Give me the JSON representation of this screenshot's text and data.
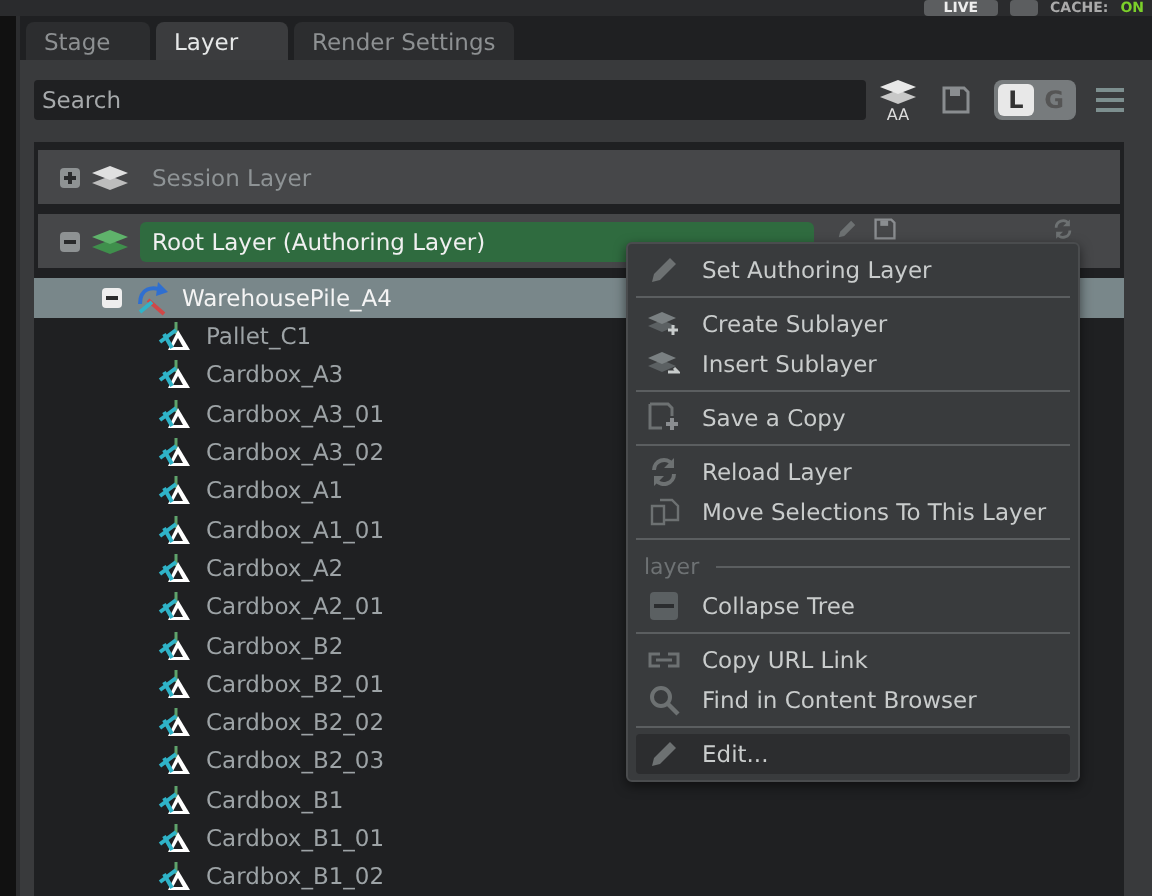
{
  "status": {
    "live": "LIVE",
    "cache_label": "CACHE:",
    "cache_value": "ON"
  },
  "tabs": [
    {
      "label": "Stage",
      "selected": false
    },
    {
      "label": "Layer",
      "selected": true
    },
    {
      "label": "Render Settings",
      "selected": false
    }
  ],
  "search": {
    "placeholder": "Search"
  },
  "toolbar": {
    "layers_caption": "AA",
    "toggle": [
      {
        "label": "L",
        "selected": true
      },
      {
        "label": "G",
        "selected": false
      }
    ]
  },
  "layers": [
    {
      "name": "Session Layer",
      "expanded": false,
      "authoring": false
    },
    {
      "name": "Root Layer (Authoring Layer)",
      "expanded": true,
      "authoring": true
    }
  ],
  "tree": [
    {
      "name": "WarehousePile_A4",
      "expanded": true,
      "selected": true,
      "children": [
        {
          "name": "Pallet_C1",
          "selected": false
        },
        {
          "name": "Cardbox_A3",
          "selected": false
        },
        {
          "name": "Cardbox_A3_01",
          "selected": false
        },
        {
          "name": "Cardbox_A3_02",
          "selected": false
        },
        {
          "name": "Cardbox_A1",
          "selected": false
        },
        {
          "name": "Cardbox_A1_01",
          "selected": false
        },
        {
          "name": "Cardbox_A2",
          "selected": false
        },
        {
          "name": "Cardbox_A2_01",
          "selected": false
        },
        {
          "name": "Cardbox_B2",
          "selected": false
        },
        {
          "name": "Cardbox_B2_01",
          "selected": false
        },
        {
          "name": "Cardbox_B2_02",
          "selected": false
        },
        {
          "name": "Cardbox_B2_03",
          "selected": false
        },
        {
          "name": "Cardbox_B1",
          "selected": false
        },
        {
          "name": "Cardbox_B1_01",
          "selected": false
        },
        {
          "name": "Cardbox_B1_02",
          "selected": false
        }
      ]
    }
  ],
  "context_menu": {
    "groups": [
      {
        "items": [
          {
            "label": "Set Authoring Layer",
            "selected": false
          }
        ]
      },
      {
        "items": [
          {
            "label": "Create Sublayer",
            "selected": false
          },
          {
            "label": "Insert Sublayer",
            "selected": false
          }
        ]
      },
      {
        "items": [
          {
            "label": "Save a Copy",
            "selected": false
          }
        ]
      },
      {
        "items": [
          {
            "label": "Reload Layer",
            "selected": false
          },
          {
            "label": "Move Selections To This Layer",
            "selected": false
          }
        ]
      },
      {
        "heading": "layer",
        "items": [
          {
            "label": "Collapse Tree",
            "selected": false
          }
        ]
      },
      {
        "items": [
          {
            "label": "Copy URL Link",
            "selected": false
          },
          {
            "label": "Find in Content Browser",
            "selected": false
          }
        ]
      },
      {
        "items": [
          {
            "label": "Edit...",
            "selected": true
          }
        ]
      }
    ]
  }
}
